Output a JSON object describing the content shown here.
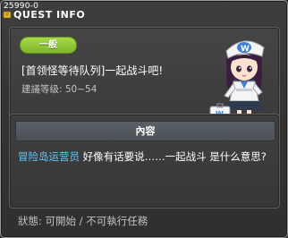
{
  "window": {
    "quest_id": "25990-0",
    "title": "QUEST INFO"
  },
  "quest": {
    "category_badge": "一般",
    "name": "[首领怪等待队列]一起战斗吧!",
    "level_text": "建議等级: 50~54"
  },
  "content": {
    "header": "內容",
    "npc_name": "冒险岛运营员",
    "text": " 好像有话要说……一起战斗 是什么意思?"
  },
  "status": {
    "text": "狀態: 可開始 / 不可執行任務"
  },
  "colors": {
    "badge_green": "#8cc63f",
    "npc_blue": "#64c8ff",
    "window_bg": "#3a3a3a"
  }
}
